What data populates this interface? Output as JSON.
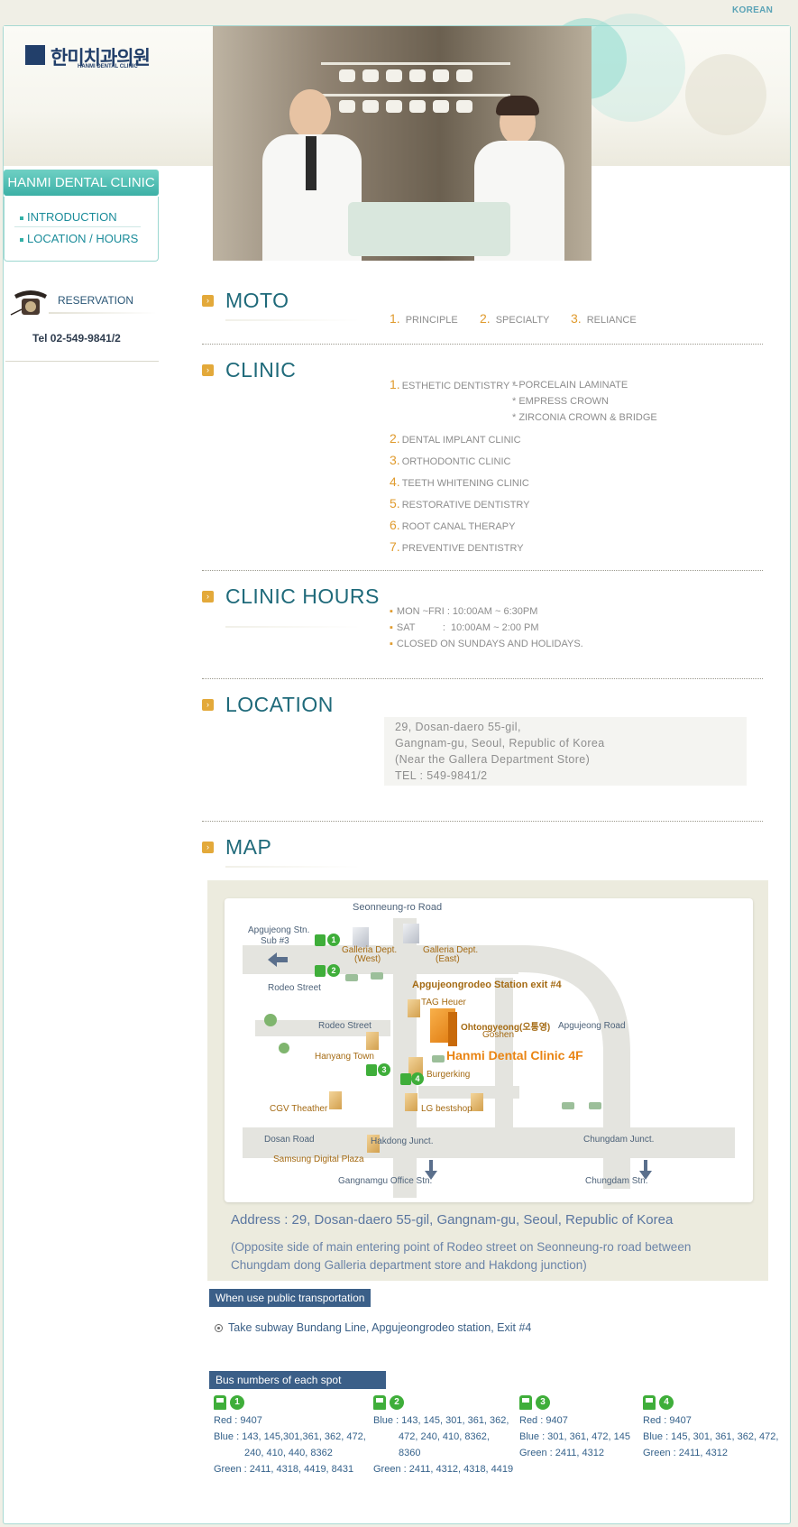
{
  "header": {
    "lang_link": "KOREAN",
    "logo_korean": "한미치과의원",
    "logo_english": "HANMI DENTAL CLINIC"
  },
  "sidebar": {
    "title": "HANMI DENTAL CLINIC",
    "items": [
      {
        "label": "INTRODUCTION"
      },
      {
        "label": "LOCATION / HOURS"
      }
    ],
    "reservation_label": "RESERVATION",
    "tel": "Tel 02-549-9841/2"
  },
  "sections": {
    "moto": {
      "title": "MOTO",
      "items": [
        {
          "num": "1.",
          "label": "PRINCIPLE"
        },
        {
          "num": "2.",
          "label": "SPECIALTY"
        },
        {
          "num": "3.",
          "label": "RELIANCE"
        }
      ]
    },
    "clinic": {
      "title": "CLINIC",
      "first": {
        "num": "1.",
        "label": "ESTHETIC DENTISTRY ~"
      },
      "sub": [
        "* PORCELAIN LAMINATE",
        "* EMPRESS CROWN",
        "* ZIRCONIA CROWN & BRIDGE"
      ],
      "items": [
        {
          "num": "2.",
          "label": "DENTAL IMPLANT CLINIC"
        },
        {
          "num": "3.",
          "label": "ORTHODONTIC CLINIC"
        },
        {
          "num": "4.",
          "label": "TEETH WHITENING CLINIC"
        },
        {
          "num": "5.",
          "label": "RESTORATIVE DENTISTRY"
        },
        {
          "num": "6.",
          "label": "ROOT CANAL THERAPY"
        },
        {
          "num": "7.",
          "label": "PREVENTIVE DENTISTRY"
        }
      ]
    },
    "hours": {
      "title": "CLINIC HOURS",
      "lines": [
        "MON ~FRI : 10:00AM ~ 6:30PM",
        "SAT          :  10:00AM ~ 2:00 PM",
        "CLOSED ON SUNDAYS AND HOLIDAYS."
      ]
    },
    "location": {
      "title": "LOCATION",
      "lines": [
        "29, Dosan-daero 55-gil,",
        "Gangnam-gu, Seoul, Republic of Korea",
        "(Near the Gallera Department Store)",
        "TEL : 549-9841/2"
      ]
    },
    "map": {
      "title": "MAP",
      "address": "Address : 29, Dosan-daero 55-gil, Gangnam-gu, Seoul, Republic of Korea",
      "note_lines": [
        "(Opposite side of main entering point of Rodeo street on Seonneung-ro road between",
        "Chungdam dong Galleria department store and Hakdong junction)"
      ],
      "labels": {
        "seonneung": "Seonneung-ro Road",
        "apgujeong_stn_1": "Apgujeong Stn.",
        "apgujeong_stn_2": "Sub #3",
        "galleria_west_1": "Galleria Dept.",
        "galleria_west_2": "(West)",
        "galleria_east_1": "Galleria Dept.",
        "galleria_east_2": "(East)",
        "rodeo_street_1": "Rodeo Street",
        "rodeo_station": "Apgujeongrodeo Station exit #4",
        "tag_heuer": "TAG Heuer",
        "rodeo_street_2": "Rodeo Street",
        "ohtongyeong": "Ohtongyeong(오통영)",
        "goshen": "Goshen",
        "apgujeong_road": "Apgujeong Road",
        "hanyang_town": "Hanyang Town",
        "hanmi": "Hanmi Dental Clinic 4F",
        "burgerking": "Burgerking",
        "cgv": "CGV Theather",
        "lg": "LG bestshop",
        "dosan_road": "Dosan Road",
        "hakdong": "Hakdong Junct.",
        "chungdam_junct": "Chungdam Junct.",
        "samsung": "Samsung Digital Plaza",
        "gangnamgu": "Gangnamgu Office Stn.",
        "chungdam_stn": "Chungdam Stn.",
        "n1": "1",
        "n2": "2",
        "n3": "3",
        "n4": "4"
      }
    },
    "transport": {
      "badge": "When use public transportation",
      "subway": "Take subway Bundang Line, Apgujeongrodeo station, Exit #4"
    },
    "bus": {
      "badge": "Bus numbers of each spot",
      "spots": [
        {
          "num": "1",
          "red": "Red : 9407",
          "blue1": "Blue :  143, 145,301,361, 362, 472,",
          "blue2": "240, 410, 440, 8362",
          "green": "Green : 2411, 4318, 4419, 8431"
        },
        {
          "num": "2",
          "blue1": "Blue : 143, 145, 301, 361, 362,",
          "blue2": "472, 240, 410, 8362,",
          "blue3": "8360",
          "green": "Green : 2411, 4312, 4318, 4419"
        },
        {
          "num": "3",
          "red": "Red : 9407",
          "blue1": "Blue : 301, 361, 472, 145",
          "green": "Green : 2411, 4312"
        },
        {
          "num": "4",
          "red": "Red : 9407",
          "blue1": "Blue : 145, 301, 361, 362, 472,",
          "green": "Green : 2411, 4312"
        }
      ]
    }
  },
  "colors": {
    "accent": "#1f6a7a",
    "orange": "#e09b2e",
    "teal": "#3cb0a6",
    "navy": "#3b5f88",
    "bus_green": "#3fae3a"
  }
}
